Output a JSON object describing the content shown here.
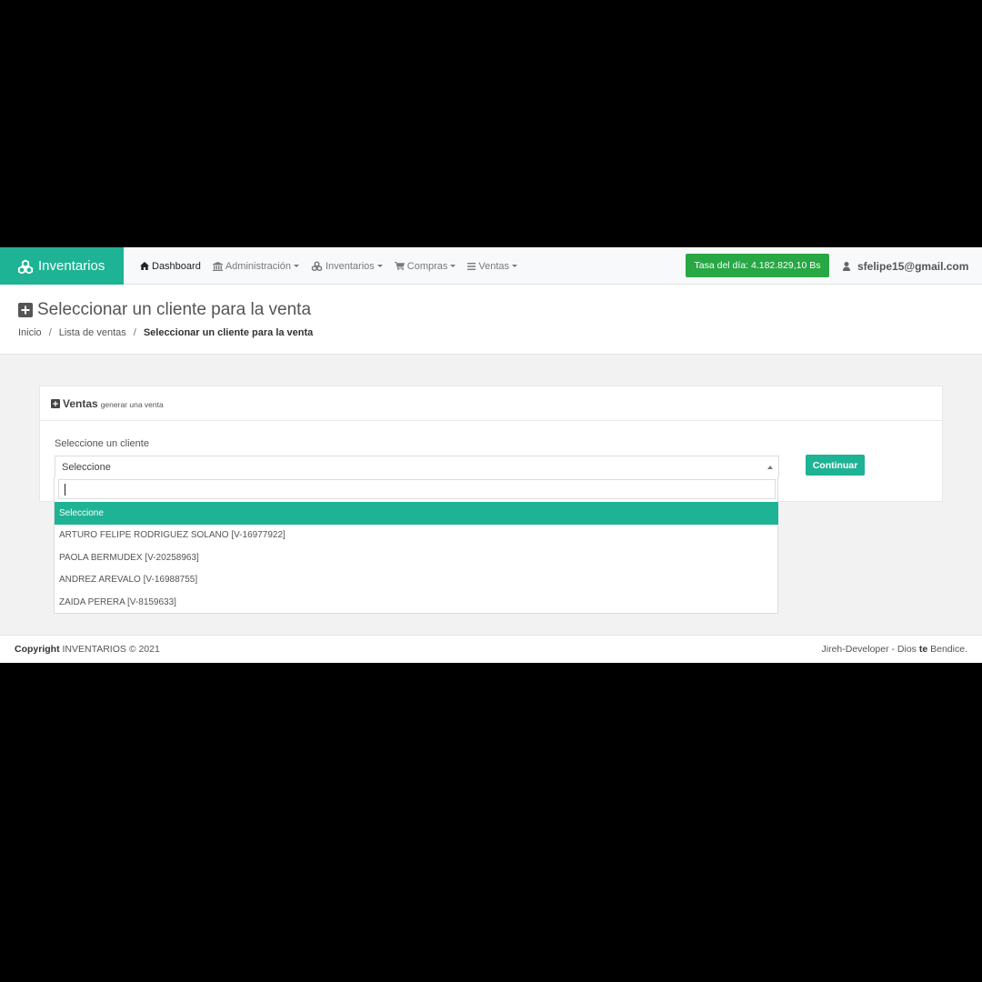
{
  "navbar": {
    "brand": "Inventarios",
    "items": [
      {
        "label": "Dashboard",
        "icon": "home-icon",
        "dropdown": false
      },
      {
        "label": "Administración",
        "icon": "bank-icon",
        "dropdown": true
      },
      {
        "label": "Inventarios",
        "icon": "cubes-icon",
        "dropdown": true
      },
      {
        "label": "Compras",
        "icon": "cart-icon",
        "dropdown": true
      },
      {
        "label": "Ventas",
        "icon": "list-icon",
        "dropdown": true
      }
    ],
    "rate": "Tasa del día: 4.182.829,10 Bs",
    "user": "sfelipe15@gmail.com"
  },
  "header": {
    "title": "Seleccionar un cliente para la venta",
    "breadcrumb": [
      "Inicio",
      "Lista de ventas",
      "Seleccionar un cliente para la venta"
    ]
  },
  "card": {
    "title": "Ventas",
    "subtitle": "generar una venta",
    "field_label": "Seleccione un cliente",
    "select_value": "Seleccione",
    "continue_label": "Continuar"
  },
  "dropdown": {
    "search_value": "",
    "options": [
      "Seleccione",
      "ARTURO FELIPE RODRIGUEZ SOLANO [V-16977922]",
      "PAOLA BERMUDEX [V-20258963]",
      "ANDREZ AREVALO [V-16988755]",
      "ZAIDA PERERA [V-8159633]"
    ],
    "selected_index": 0
  },
  "footer": {
    "copyright_label": "Copyright",
    "copyright_text": "INVENTARIOS © 2021",
    "right_prefix": "Jireh-Developer - Dios",
    "right_bold": "te",
    "right_suffix": "Bendice."
  },
  "colors": {
    "accent": "#1eb394",
    "rate_badge": "#28a745"
  }
}
